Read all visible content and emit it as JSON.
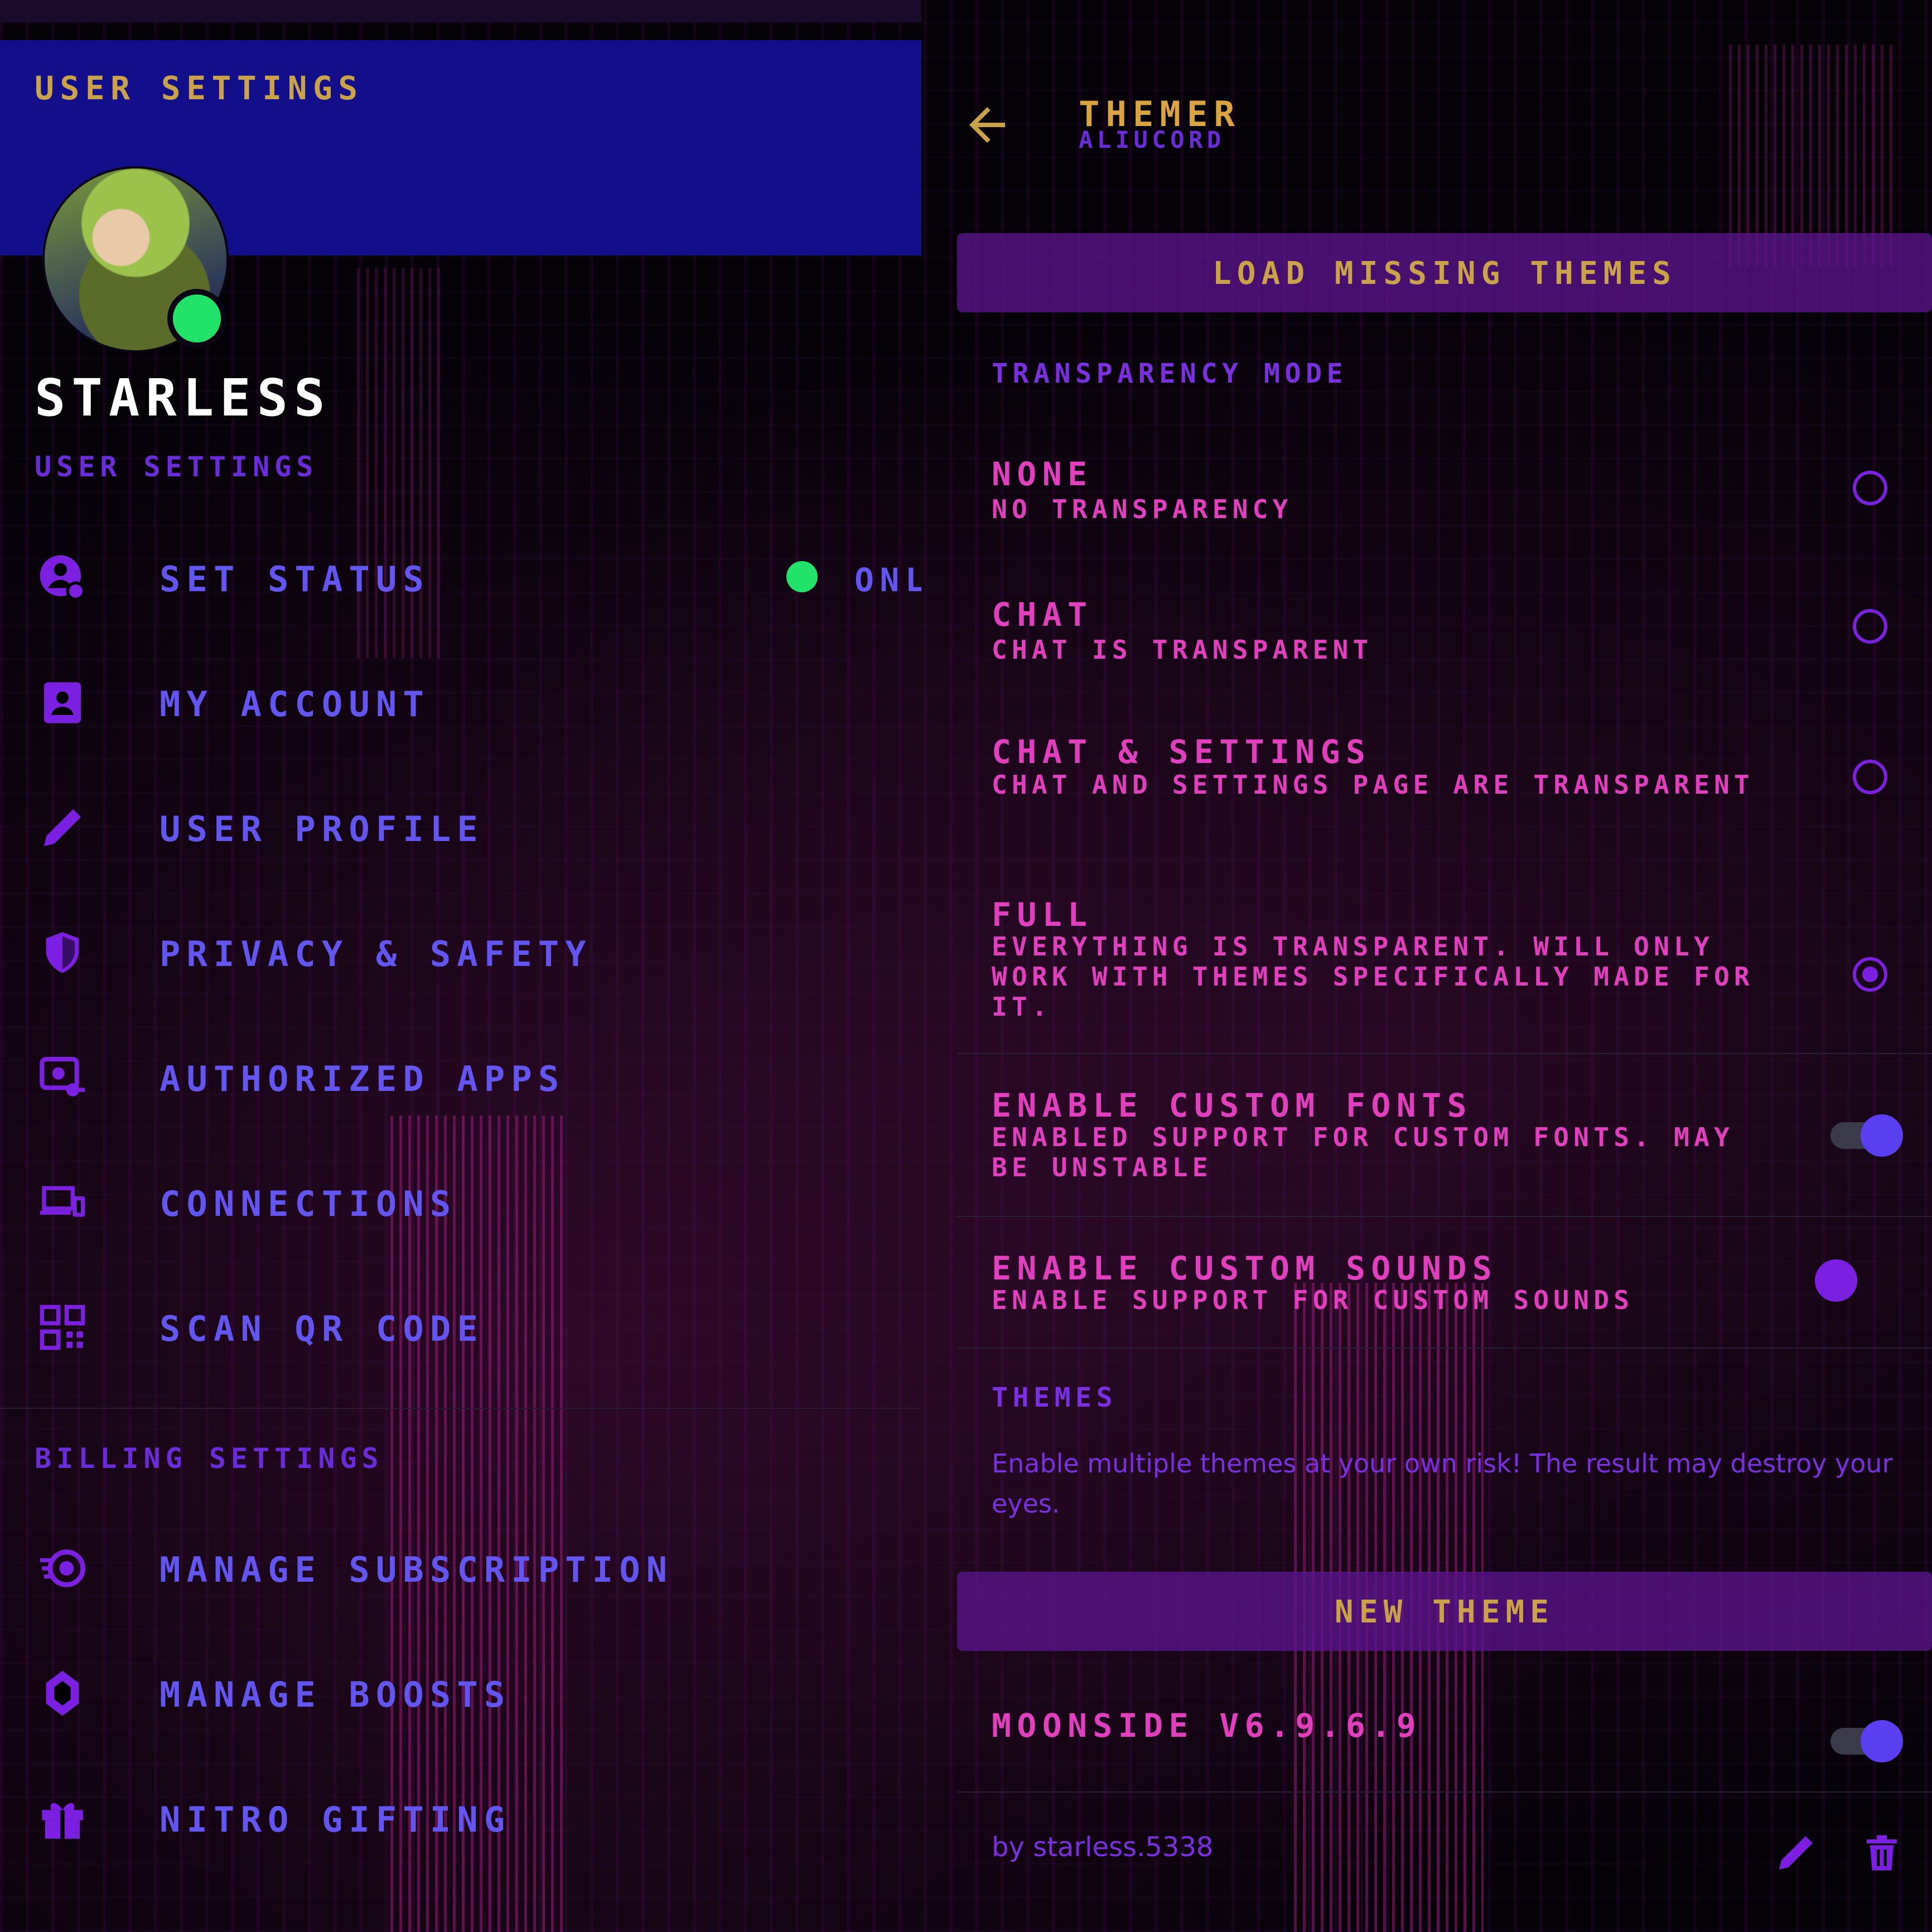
{
  "left": {
    "header_title": "User Settings",
    "username": "Starless",
    "section_user": "User Settings",
    "menu": [
      {
        "label": "Set Status",
        "icon": "person-status-icon"
      },
      {
        "label": "My Account",
        "icon": "account-card-icon"
      },
      {
        "label": "User Profile",
        "icon": "pencil-icon"
      },
      {
        "label": "Privacy & Safety",
        "icon": "shield-icon"
      },
      {
        "label": "Authorized Apps",
        "icon": "authorized-apps-icon"
      },
      {
        "label": "Connections",
        "icon": "devices-icon"
      },
      {
        "label": "Scan QR Code",
        "icon": "qr-code-icon"
      }
    ],
    "status_value": "Online",
    "section_billing": "Billing Settings",
    "billing": [
      {
        "label": "Manage Subscription",
        "icon": "nitro-icon"
      },
      {
        "label": "Manage Boosts",
        "icon": "boost-gem-icon"
      },
      {
        "label": "Nitro Gifting",
        "icon": "gift-icon"
      }
    ]
  },
  "right": {
    "title": "Themer",
    "subtitle": "Aliucord",
    "load_button": "Load missing themes",
    "section_transparency": "Transparency Mode",
    "modes": [
      {
        "title": "None",
        "desc": "No transparency",
        "selected": false
      },
      {
        "title": "Chat",
        "desc": "Chat is transparent",
        "selected": false
      },
      {
        "title": "Chat & Settings",
        "desc": "Chat and Settings page are transparent",
        "selected": false
      },
      {
        "title": "Full",
        "desc": "Everything is transparent. Will only work with themes specifically made for it.",
        "selected": true
      }
    ],
    "toggles": [
      {
        "title": "Enable Custom Fonts",
        "desc": "Enabled support for custom fonts. May be unstable",
        "on": true
      },
      {
        "title": "Enable Custom Sounds",
        "desc": "Enable support for custom sounds",
        "on": false
      }
    ],
    "section_themes": "Themes",
    "help": "Enable multiple themes at your own risk! The result may destroy your eyes.",
    "new_theme_button": "New theme",
    "theme": {
      "name": "Moonside v6.9.6.9",
      "on": true
    },
    "author": "by starless.5338"
  },
  "colors": {
    "header_blue": "#130e8a",
    "accent_purple": "#7b1fe0",
    "menu_text": "#6356f0",
    "pink_text": "#e23fbf",
    "gold_text": "#c9a24a",
    "online_green": "#22e36a"
  }
}
